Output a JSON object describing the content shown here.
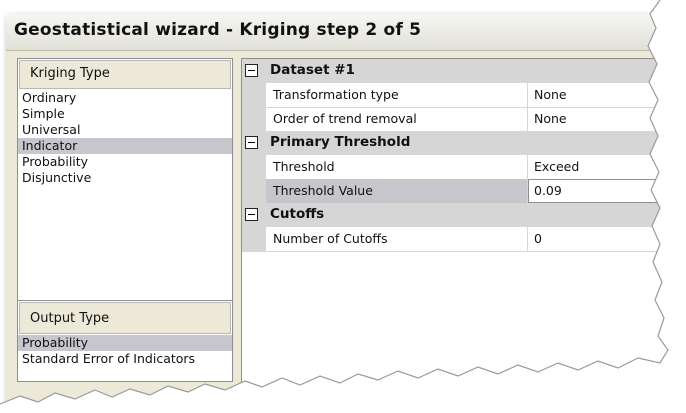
{
  "window": {
    "title": "Geostatistical wizard - Kriging step 2 of 5"
  },
  "kriging_type": {
    "header": "Kriging Type",
    "items": [
      "Ordinary",
      "Simple",
      "Universal",
      "Indicator",
      "Probability",
      "Disjunctive"
    ],
    "selected": "Indicator"
  },
  "output_type": {
    "header": "Output Type",
    "items": [
      "Probability",
      "Standard Error of Indicators"
    ],
    "selected": "Probability"
  },
  "grid": {
    "dataset": {
      "label": "Dataset #1",
      "rows": [
        {
          "name": "Transformation type",
          "value": "None"
        },
        {
          "name": "Order of trend removal",
          "value": "None"
        }
      ]
    },
    "primary_threshold": {
      "label": "Primary Threshold",
      "rows": [
        {
          "name": "Threshold",
          "value": "Exceed"
        },
        {
          "name": "Threshold Value",
          "value": "0.09"
        }
      ]
    },
    "cutoffs": {
      "label": "Cutoffs",
      "rows": [
        {
          "name": "Number of Cutoffs",
          "value": "0"
        }
      ]
    }
  },
  "icons": {
    "collapse": "minus-box-icon"
  },
  "colors": {
    "category_band": "#d6d6d6",
    "selection": "#c6c6cc",
    "dialog_face": "#ece9d8"
  }
}
